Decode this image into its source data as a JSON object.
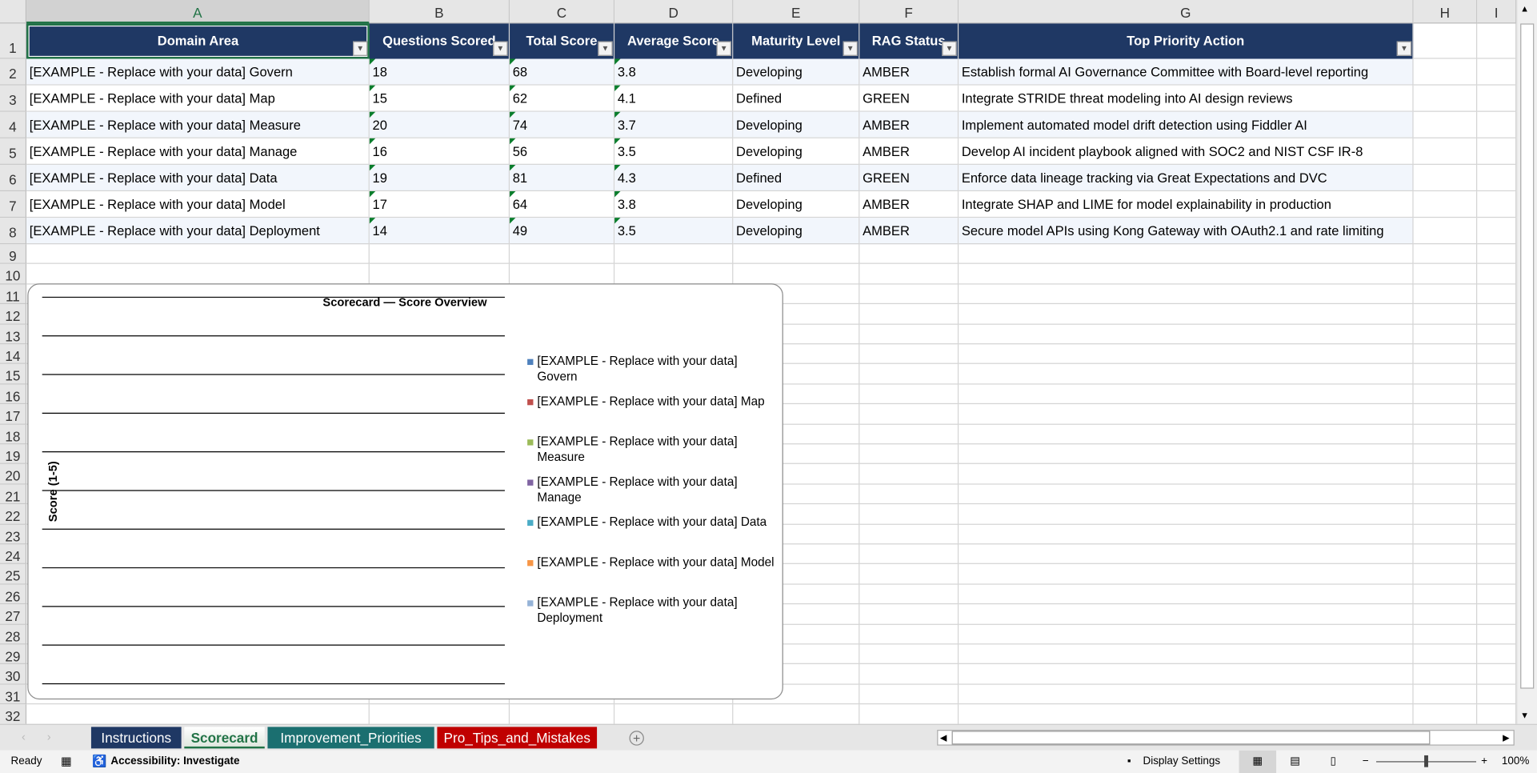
{
  "columns": [
    "A",
    "B",
    "C",
    "D",
    "E",
    "F",
    "G",
    "H",
    "I"
  ],
  "headers": [
    "Domain Area",
    "Questions Scored",
    "Total Score",
    "Average Score",
    "Maturity Level",
    "RAG Status",
    "Top Priority Action"
  ],
  "rows": [
    [
      "[EXAMPLE - Replace with your data] Govern",
      "18",
      "68",
      "3.8",
      "Developing",
      "AMBER",
      "Establish formal AI Governance Committee with Board-level reporting"
    ],
    [
      "[EXAMPLE - Replace with your data] Map",
      "15",
      "62",
      "4.1",
      "Defined",
      "GREEN",
      "Integrate STRIDE threat modeling into AI design reviews"
    ],
    [
      "[EXAMPLE - Replace with your data] Measure",
      "20",
      "74",
      "3.7",
      "Developing",
      "AMBER",
      "Implement automated model drift detection using Fiddler AI"
    ],
    [
      "[EXAMPLE - Replace with your data] Manage",
      "16",
      "56",
      "3.5",
      "Developing",
      "AMBER",
      "Develop AI incident playbook aligned with SOC2 and NIST CSF IR-8"
    ],
    [
      "[EXAMPLE - Replace with your data] Data",
      "19",
      "81",
      "4.3",
      "Defined",
      "GREEN",
      "Enforce data lineage tracking via Great Expectations and DVC"
    ],
    [
      "[EXAMPLE - Replace with your data] Model",
      "17",
      "64",
      "3.8",
      "Developing",
      "AMBER",
      "Integrate SHAP and LIME for model explainability in production"
    ],
    [
      "[EXAMPLE - Replace with your data] Deployment",
      "14",
      "49",
      "3.5",
      "Developing",
      "AMBER",
      "Secure model APIs using Kong Gateway with OAuth2.1 and rate limiting"
    ]
  ],
  "chart": {
    "title": "Scorecard — Score Overview",
    "ylabel": "Score (1-5)",
    "legend": [
      {
        "label": "[EXAMPLE - Replace with your data] Govern",
        "color": "#4f81bd"
      },
      {
        "label": "[EXAMPLE - Replace with your data] Map",
        "color": "#c0504d"
      },
      {
        "label": "[EXAMPLE - Replace with your data] Measure",
        "color": "#9bbb59"
      },
      {
        "label": "[EXAMPLE - Replace with your data] Manage",
        "color": "#8064a2"
      },
      {
        "label": "[EXAMPLE - Replace with your data] Data",
        "color": "#4bacc6"
      },
      {
        "label": "[EXAMPLE - Replace with your data] Model",
        "color": "#f79646"
      },
      {
        "label": "[EXAMPLE - Replace with your data] Deployment",
        "color": "#95b3d7"
      }
    ]
  },
  "tabs": [
    {
      "label": "Instructions",
      "color": "#1f3864"
    },
    {
      "label": "Scorecard",
      "color": "#ffffff",
      "active": true
    },
    {
      "label": "Improvement_Priorities",
      "color": "#1b6f70"
    },
    {
      "label": "Pro_Tips_and_Mistakes",
      "color": "#c00000"
    }
  ],
  "status": {
    "ready": "Ready",
    "accessibility": "Accessibility: Investigate",
    "display_settings": "Display Settings",
    "zoom": "100%",
    "minus": "−",
    "plus": "+"
  }
}
